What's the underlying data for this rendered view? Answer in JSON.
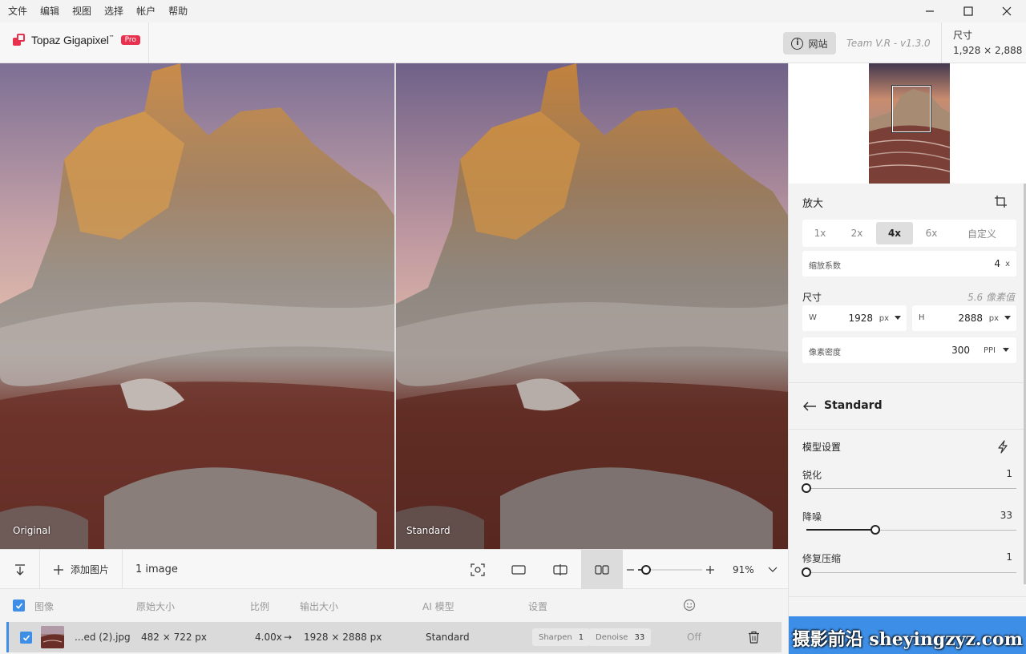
{
  "menu": [
    "文件",
    "编辑",
    "视图",
    "选择",
    "帐户",
    "帮助"
  ],
  "window_controls": [
    "minimize-icon",
    "maximize-icon",
    "close-icon"
  ],
  "header": {
    "app_name": "Topaz Gigapixel",
    "trademark": "™",
    "badge": "Pro",
    "site_button": "网站",
    "version": "Team V.R - v1.3.0",
    "size_label": "尺寸",
    "size_value": "1,928 × 2,888"
  },
  "viewer": {
    "left_label": "Original",
    "right_label": "Standard"
  },
  "toolbar": {
    "add_label": "添加图片",
    "image_count": "1 image",
    "zoom_value": "91%",
    "zoom_level": 0.18,
    "icons": [
      "sort-down-icon",
      "plus-icon",
      "screenshot-icon",
      "single-view-icon",
      "split-view-icon",
      "side-by-side-icon",
      "zoom-out-icon",
      "zoom-in-icon",
      "chevron-down-icon"
    ]
  },
  "table": {
    "columns": [
      "图像",
      "原始大小",
      "比例",
      "输出大小",
      "AI 模型",
      "设置"
    ],
    "rows": [
      {
        "name": "...ed (2).jpg",
        "original": "482 × 722 px",
        "scale": "4.00x",
        "arrow": "→",
        "output": "1928 × 2888 px",
        "model": "Standard",
        "sharpen_label": "Sharpen",
        "sharpen_value": "1",
        "denoise_label": "Denoise",
        "denoise_value": "33",
        "face": "Off"
      }
    ]
  },
  "panel": {
    "upscale_title": "放大",
    "scale_options": [
      "1x",
      "2x",
      "4x",
      "6x",
      "自定义"
    ],
    "selected_scale": "4x",
    "factor_label": "缩放系数",
    "factor_value": "4",
    "factor_unit": "x",
    "dim_title": "尺寸",
    "dim_note": "5.6 像素值",
    "w_label": "W",
    "w_value": "1928",
    "w_unit": "px",
    "h_label": "H",
    "h_value": "2888",
    "h_unit": "px",
    "ppi_label": "像素密度",
    "ppi_value": "300",
    "ppi_unit": "PPI",
    "model_name": "Standard",
    "model_settings": "模型设置",
    "sliders": [
      {
        "label": "锐化",
        "value": "1",
        "level": 0.0
      },
      {
        "label": "降噪",
        "value": "33",
        "level": 0.33
      },
      {
        "label": "修复压缩",
        "value": "1",
        "level": 0.0
      }
    ],
    "watermark": "摄影前沿 sheyingzyz.com"
  },
  "colors": {
    "accent": "#3d8ee6",
    "brand": "#e8304f"
  }
}
